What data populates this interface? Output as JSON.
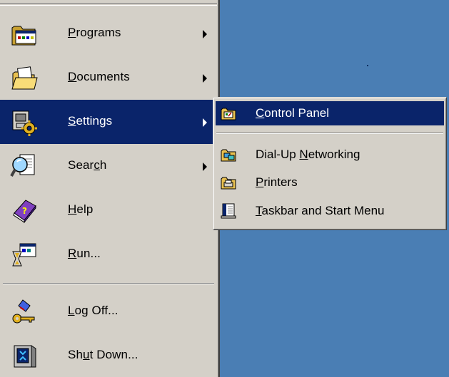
{
  "start_menu": {
    "items": [
      {
        "pre": "",
        "key": "P",
        "post": "rograms",
        "has_submenu": true,
        "icon": "programs-folder-icon",
        "active": false
      },
      {
        "pre": "",
        "key": "D",
        "post": "ocuments",
        "has_submenu": true,
        "icon": "documents-folder-icon",
        "active": false
      },
      {
        "pre": "",
        "key": "S",
        "post": "ettings",
        "has_submenu": true,
        "icon": "settings-icon",
        "active": true
      },
      {
        "pre": "Sear",
        "key": "c",
        "post": "h",
        "has_submenu": true,
        "icon": "search-icon",
        "active": false
      },
      {
        "pre": "",
        "key": "H",
        "post": "elp",
        "has_submenu": false,
        "icon": "help-book-icon",
        "active": false
      },
      {
        "pre": "",
        "key": "R",
        "post": "un...",
        "has_submenu": false,
        "icon": "run-icon",
        "active": false
      },
      {
        "pre": "",
        "key": "L",
        "post": "og Off...",
        "has_submenu": false,
        "icon": "log-off-key-icon",
        "active": false
      },
      {
        "pre": "Sh",
        "key": "u",
        "post": "t Down...",
        "has_submenu": false,
        "icon": "shut-down-icon",
        "active": false
      }
    ]
  },
  "settings_submenu": {
    "items": [
      {
        "pre": "",
        "key": "C",
        "post": "ontrol Panel",
        "icon": "control-panel-folder-icon",
        "active": true
      },
      {
        "pre": "Dial-Up ",
        "key": "N",
        "post": "etworking",
        "icon": "dial-up-networking-icon",
        "active": false
      },
      {
        "pre": "",
        "key": "P",
        "post": "rinters",
        "icon": "printers-folder-icon",
        "active": false
      },
      {
        "pre": "",
        "key": "T",
        "post": "askbar and Start Menu",
        "icon": "taskbar-icon",
        "active": false
      }
    ]
  },
  "colors": {
    "desktop": "#4a7eb4",
    "menu_face": "#d4d0c8",
    "highlight": "#0a246a",
    "highlight_text": "#ffffff"
  }
}
